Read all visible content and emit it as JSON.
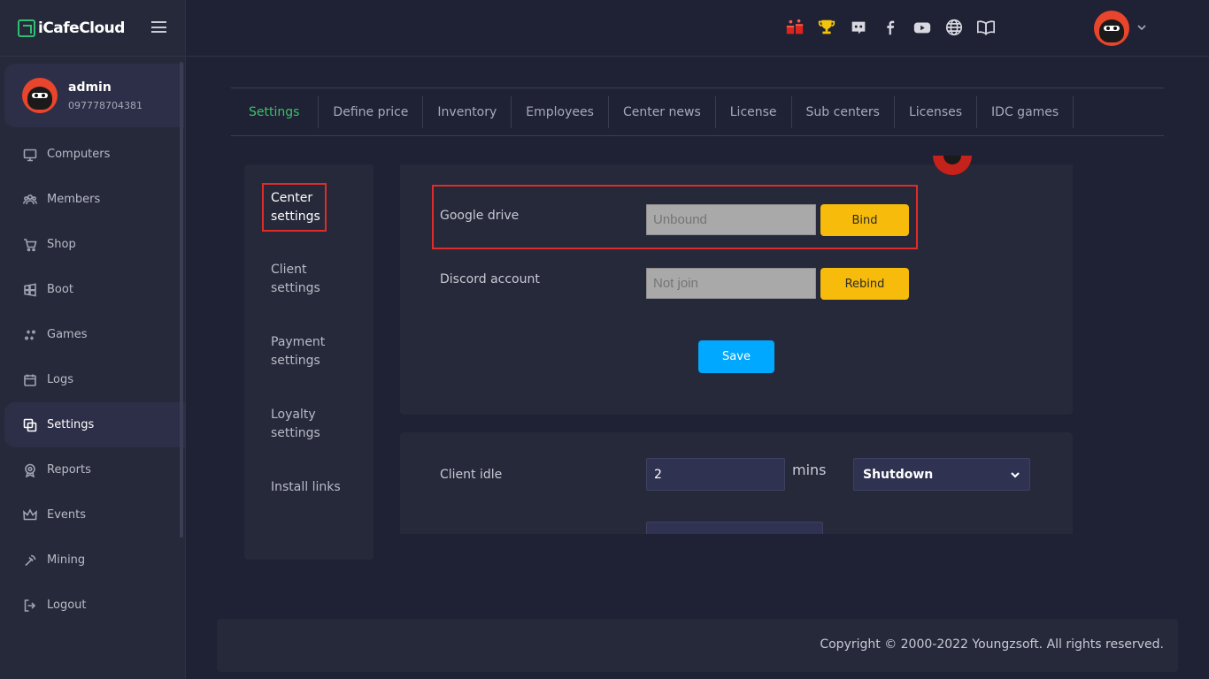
{
  "app": {
    "logo_text": "iCafeCloud"
  },
  "user": {
    "name": "admin",
    "phone": "097778704381"
  },
  "sidebar": {
    "items": [
      {
        "label": "Computers",
        "icon": "monitor-icon"
      },
      {
        "label": "Members",
        "icon": "members-icon"
      },
      {
        "label": "Shop",
        "icon": "cart-icon"
      },
      {
        "label": "Boot",
        "icon": "windows-icon"
      },
      {
        "label": "Games",
        "icon": "gamepad-icon"
      },
      {
        "label": "Logs",
        "icon": "calendar-icon"
      },
      {
        "label": "Settings",
        "icon": "settings-icon",
        "active": true
      },
      {
        "label": "Reports",
        "icon": "reports-icon"
      },
      {
        "label": "Events",
        "icon": "crown-icon"
      },
      {
        "label": "Mining",
        "icon": "pickaxe-icon"
      },
      {
        "label": "Logout",
        "icon": "logout-icon"
      }
    ]
  },
  "topbar": {
    "icons": [
      "gifts-icon",
      "trophy-icon",
      "discord-icon",
      "facebook-icon",
      "youtube-icon",
      "globe-icon",
      "book-icon"
    ]
  },
  "tabs": [
    "Settings",
    "Define price",
    "Inventory",
    "Employees",
    "Center news",
    "License",
    "Sub centers",
    "Licenses",
    "IDC games"
  ],
  "submenu": {
    "center": "Center\nsettings",
    "client": "Client\nsettings",
    "payment": "Payment\nsettings",
    "loyalty": "Loyalty\nsettings",
    "install": "Install links"
  },
  "center_settings": {
    "google_drive_label": "Google drive",
    "google_drive_placeholder": "Unbound",
    "bind_label": "Bind",
    "discord_label": "Discord account",
    "discord_placeholder": "Not join",
    "rebind_label": "Rebind",
    "save_label": "Save"
  },
  "client_settings": {
    "idle_label": "Client idle",
    "idle_value": "2",
    "idle_unit": "mins",
    "idle_action": "Shutdown"
  },
  "footer": {
    "copyright": "Copyright © 2000-2022 Youngzsoft. All rights reserved."
  },
  "colors": {
    "accent_green": "#3ec06a",
    "highlight_red": "#e02b2b",
    "button_yellow": "#f6bb0b",
    "save_blue": "#00a8ff"
  }
}
